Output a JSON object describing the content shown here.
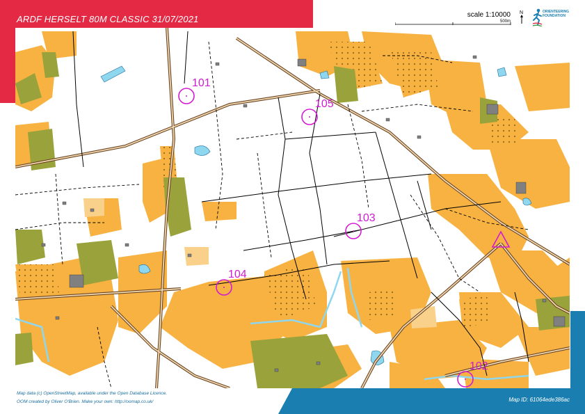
{
  "header": {
    "title": "ARDF  HERSELT 80M CLASSIC 31/07/2021",
    "scale": "scale 1:10000",
    "scale_unit": "500m",
    "north_label": "N",
    "logo_text_line1": "ORIENTEERING",
    "logo_text_line2": "FOUNDATION"
  },
  "footer": {
    "credit_line1": "Map data (c) OpenStreetMap, available under the Open Database Licence.",
    "credit_line2": "OOM created by Oliver O'Brien. Make your own: http://oomap.co.uk/",
    "map_id": "Map ID: 61064ede386ac"
  },
  "controls": [
    {
      "label": "101"
    },
    {
      "label": "105"
    },
    {
      "label": "103"
    },
    {
      "label": "104"
    },
    {
      "label": "102"
    }
  ],
  "colors": {
    "corner_red": "#e42945",
    "corner_blue": "#1a7fb0",
    "open_land": "#f7b242",
    "rough_open": "#fad18b",
    "vegetation": "#9aa33b",
    "water": "#8fd6ef",
    "road": "#6b4423",
    "control": "#d21bd2"
  }
}
